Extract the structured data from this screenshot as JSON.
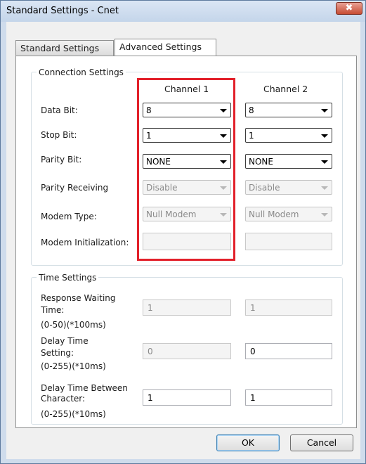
{
  "window": {
    "title": "Standard Settings - Cnet",
    "close_glyph": "✖"
  },
  "tabs": [
    {
      "label": "Standard Settings",
      "selected": false
    },
    {
      "label": "Advanced Settings",
      "selected": true
    }
  ],
  "connection": {
    "group_title": "Connection Settings",
    "channel1_header": "Channel 1",
    "channel2_header": "Channel 2",
    "rows": [
      {
        "label": "Data Bit:",
        "ch1": "8",
        "ch2": "8"
      },
      {
        "label": "Stop Bit:",
        "ch1": "1",
        "ch2": "1"
      },
      {
        "label": "Parity Bit:",
        "ch1": "NONE",
        "ch2": "NONE"
      },
      {
        "label": "Parity Receiving",
        "ch1": "Disable",
        "ch2": "Disable"
      },
      {
        "label": "Modem Type:",
        "ch1": "Null Modem",
        "ch2": "Null Modem"
      },
      {
        "label": "Modem Initialization:",
        "ch1": "",
        "ch2": ""
      }
    ]
  },
  "time": {
    "group_title": "Time Settings",
    "response": {
      "label1": "Response Waiting",
      "label2": "Time:",
      "range": "(0-50)(*100ms)",
      "ch1": "1",
      "ch2": "1"
    },
    "delay": {
      "label1": "Delay Time",
      "label2": "Setting:",
      "range": "(0-255)(*10ms)",
      "ch1": "0",
      "ch2": "0"
    },
    "between": {
      "label1": "Delay Time Between",
      "label2": "Character:",
      "range": "(0-255)(*10ms)",
      "ch1": "1",
      "ch2": "1"
    }
  },
  "buttons": {
    "ok": "OK",
    "cancel": "Cancel"
  },
  "colors": {
    "highlight": "#e2202a",
    "title_bar": "#c4d5ea",
    "close_button": "#c74b32"
  }
}
